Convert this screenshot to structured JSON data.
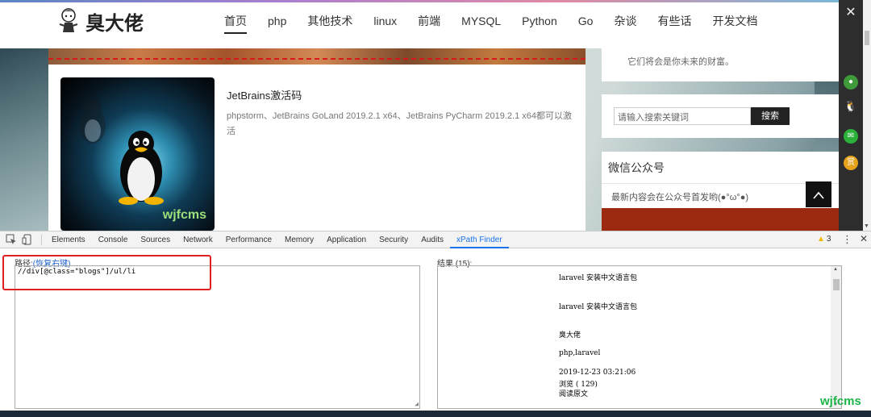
{
  "site": {
    "logo_text": "臭大佬",
    "nav": [
      "首页",
      "php",
      "其他技术",
      "linux",
      "前端",
      "MYSQL",
      "Python",
      "Go",
      "杂谈",
      "有些话",
      "开发文档"
    ],
    "article": {
      "title": "JetBrains激活码",
      "description": "phpstorm、JetBrains GoLand 2019.2.1 x64、JetBrains PyCharm 2019.2.1 x64都可以激活",
      "thumb_watermark": "wjfcms"
    },
    "sidebar": {
      "note": "它们将会是你未来的财富。",
      "search_placeholder": "请输入搜索关键词",
      "search_button": "搜索",
      "wechat_title": "微信公众号",
      "wechat_text": "最新内容会在公众号首发哟(●°ω°●)"
    },
    "back_top": "^"
  },
  "side_panel": {
    "close": "✕",
    "icons": [
      "chrome-icon",
      "qq-icon",
      "wechat-icon",
      "reward-icon"
    ]
  },
  "devtools": {
    "tabs": [
      "Elements",
      "Console",
      "Sources",
      "Network",
      "Performance",
      "Memory",
      "Application",
      "Security",
      "Audits",
      "xPath Finder"
    ],
    "active_tab": "xPath Finder",
    "warnings": "3",
    "path_label": "路径:",
    "path_link": "(恢复右键)",
    "xpath": "//div[@class=\"blogs\"]/ul/li",
    "result_label": "结果 (15):",
    "results": [
      "laravel 安装中文语言包",
      "laravel 安装中文语言包",
      "臭大佬",
      "php,laravel",
      "2019-12-23 03:21:06",
      "浏览 ( 129)",
      "阅读原文"
    ]
  },
  "watermark": "wjfcms",
  "colors": {
    "accent_red": "#e02020",
    "link_blue": "#1a5fcc",
    "devtools_active": "#1a73e8",
    "watermark_green": "#1db44a"
  }
}
